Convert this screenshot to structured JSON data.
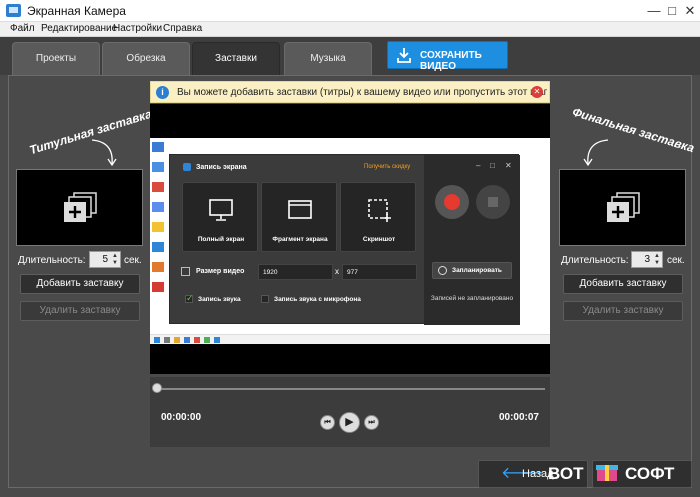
{
  "window": {
    "title": "Экранная Камера",
    "controls": [
      "—",
      "□",
      "✕"
    ]
  },
  "menu": [
    "Файл",
    "Редактирование",
    "Настройки",
    "Справка"
  ],
  "tabs": [
    "Проекты",
    "Обрезка",
    "Заставки",
    "Музыка"
  ],
  "active_tab": "Заставки",
  "save_button": "СОХРАНИТЬ ВИДЕО",
  "notice": {
    "text": "Вы можете добавить заставки (титры) к вашему видео или пропустить этот шаг"
  },
  "left_panel": {
    "title": "Титульная заставка",
    "duration_label": "Длительность:",
    "duration_value": "5",
    "duration_unit": "сек.",
    "add_button": "Добавить заставку",
    "remove_button": "Удалить заставку"
  },
  "right_panel": {
    "title": "Финальная заставка",
    "duration_label": "Длительность:",
    "duration_value": "3",
    "duration_unit": "сек.",
    "add_button": "Добавить заставку",
    "remove_button": "Удалить заставку"
  },
  "recorder": {
    "title": "Запись экрана",
    "discount": "Получить скидку",
    "modes": [
      "Полный экран",
      "Фрагмент экрана",
      "Скриншот"
    ],
    "size_label": "Размер видео",
    "width": "1920",
    "x": "x",
    "height": "977",
    "sound_label": "Запись звука",
    "mic_label": "Запись звука с микрофона",
    "schedule_button": "Запланировать",
    "no_schedule": "Записей не запланировано"
  },
  "timeline": {
    "current": "00:00:00",
    "total": "00:00:07",
    "progress": 0
  },
  "bottom": {
    "back": "Назад"
  },
  "watermark": {
    "left": "ВОТ",
    "right": "СОФТ"
  },
  "colors": {
    "accent": "#1e8fe0",
    "record": "#e53a30",
    "warning_bg": "#fbf0c4"
  }
}
